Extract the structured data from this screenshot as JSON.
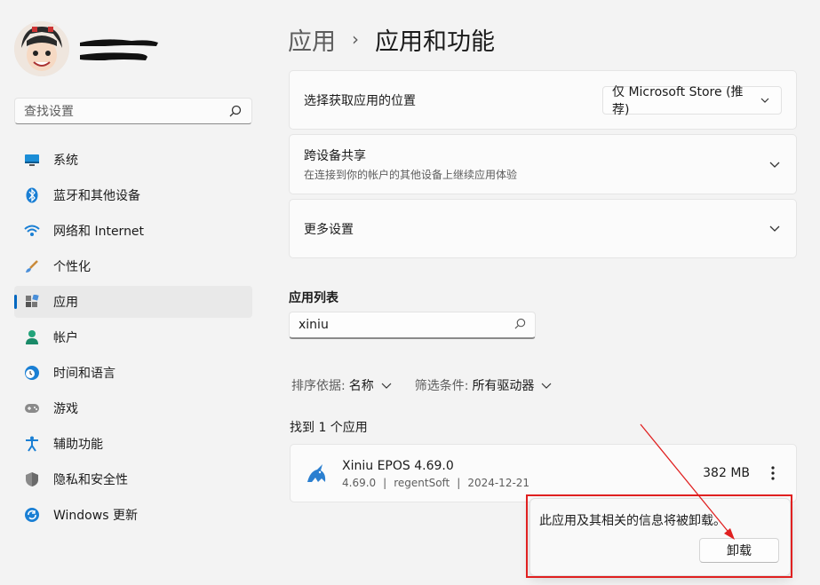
{
  "sidebar": {
    "search_placeholder": "查找设置",
    "items": [
      {
        "label": "系统",
        "icon": "monitor-icon"
      },
      {
        "label": "蓝牙和其他设备",
        "icon": "bluetooth-icon"
      },
      {
        "label": "网络和 Internet",
        "icon": "wifi-icon"
      },
      {
        "label": "个性化",
        "icon": "brush-icon"
      },
      {
        "label": "应用",
        "icon": "apps-icon",
        "active": true
      },
      {
        "label": "帐户",
        "icon": "person-icon"
      },
      {
        "label": "时间和语言",
        "icon": "clock-globe-icon"
      },
      {
        "label": "游戏",
        "icon": "gamepad-icon"
      },
      {
        "label": "辅助功能",
        "icon": "accessibility-icon"
      },
      {
        "label": "隐私和安全性",
        "icon": "shield-icon"
      },
      {
        "label": "Windows 更新",
        "icon": "update-icon"
      }
    ]
  },
  "breadcrumb": {
    "parent": "应用",
    "separator": "›",
    "current": "应用和功能"
  },
  "cards": {
    "source": {
      "title": "选择获取应用的位置",
      "dropdown_value": "仅 Microsoft Store (推荐)"
    },
    "share": {
      "title": "跨设备共享",
      "subtitle": "在连接到你的帐户的其他设备上继续应用体验"
    },
    "more": {
      "title": "更多设置"
    }
  },
  "app_list": {
    "title": "应用列表",
    "search_value": "xiniu",
    "sort_label": "排序依据:",
    "sort_value": "名称",
    "filter_label": "筛选条件:",
    "filter_value": "所有驱动器",
    "found_text": "找到 1 个应用",
    "apps": [
      {
        "name": "Xiniu EPOS 4.69.0",
        "version": "4.69.0",
        "publisher": "regentSoft",
        "date": "2024-12-21",
        "size": "382 MB"
      }
    ]
  },
  "flyout": {
    "message": "此应用及其相关的信息将被卸载。",
    "uninstall_label": "卸载"
  },
  "colors": {
    "accent": "#0067c0",
    "annotation_red": "#e02020"
  }
}
